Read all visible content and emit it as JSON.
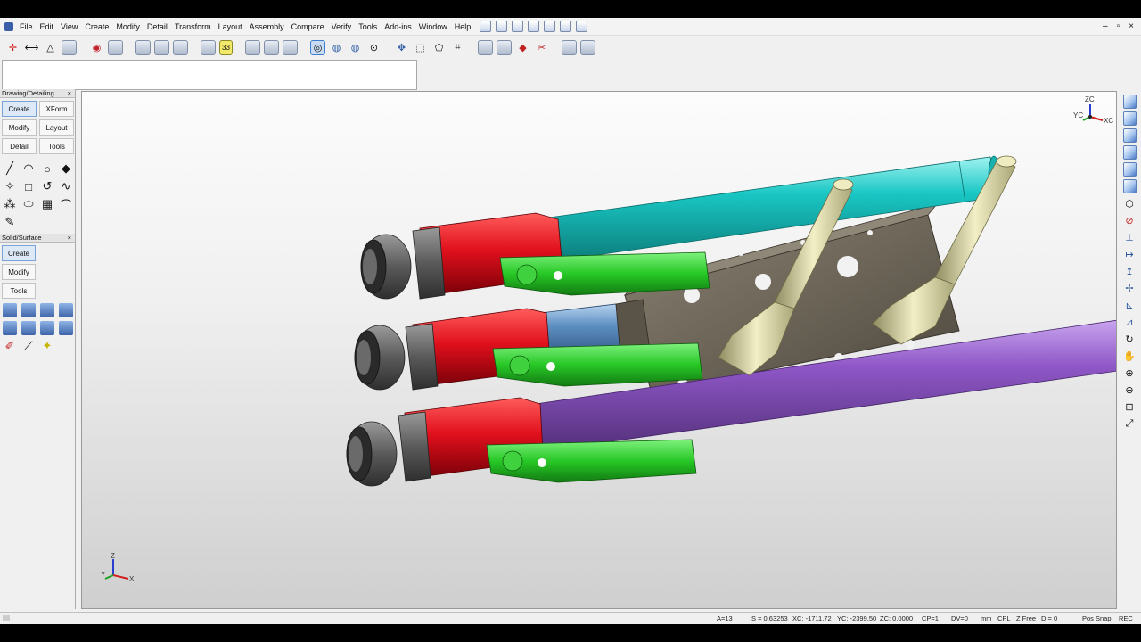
{
  "menubar": {
    "items": [
      "File",
      "Edit",
      "View",
      "Create",
      "Modify",
      "Detail",
      "Transform",
      "Layout",
      "Assembly",
      "Compare",
      "Verify",
      "Tools",
      "Add-ins",
      "Window",
      "Help"
    ],
    "window_controls": [
      "–",
      "▫",
      "×"
    ]
  },
  "left_panel": {
    "drawing_header": "Drawing/Detailing",
    "drawing_buttons": [
      "Create",
      "XForm",
      "Modify",
      "Layout",
      "Detail",
      "Tools"
    ],
    "solid_header": "Solid/Surface",
    "solid_buttons": [
      "Create",
      "Modify",
      "Tools"
    ],
    "close_glyph": "×"
  },
  "toolbar": {
    "layer_number": "33"
  },
  "triad": {
    "zc": "ZC",
    "yc": "YC",
    "xc": "XC",
    "z": "Z",
    "y": "Y",
    "x": "X"
  },
  "status": {
    "a": "A=13",
    "s": "S = 0.63253",
    "xc": "XC: -1711.72",
    "yc": "YC: -2399.50",
    "zc": "ZC: 0.0000",
    "cp": "CP=1",
    "dv": "DV=0",
    "units": "mm",
    "cpl": "CPL",
    "zfree": "Z Free",
    "d": "D = 0",
    "possnap": "Pos Snap",
    "rec": "REC"
  },
  "colors": {
    "cyan_pipe": "#19c7c4",
    "purple_pipe": "#8f57c7",
    "blue_pipe": "#5c8ec0",
    "valve_red": "#e0101c",
    "handle_green": "#27c826",
    "block_gray": "#6b6355",
    "fitting_yellow": "#e2dfad",
    "coupling_gray": "#5a5a5a"
  }
}
